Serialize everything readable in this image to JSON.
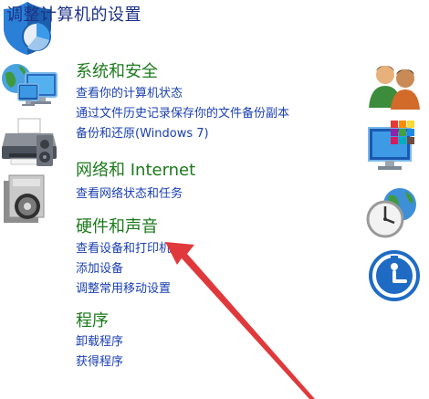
{
  "page": {
    "title": "调整计算机的设置"
  },
  "categories": [
    {
      "title": "系统和安全",
      "icon": "shield-icon",
      "links": [
        "查看你的计算机状态",
        "通过文件历史记录保存你的文件备份副本",
        "备份和还原(Windows 7)"
      ]
    },
    {
      "title": "网络和 Internet",
      "icon": "network-icon",
      "links": [
        "查看网络状态和任务"
      ]
    },
    {
      "title": "硬件和声音",
      "icon": "printer-icon",
      "links": [
        "查看设备和打印机",
        "添加设备",
        "调整常用移动设置"
      ]
    },
    {
      "title": "程序",
      "icon": "programs-icon",
      "links": [
        "卸载程序",
        "获得程序"
      ]
    }
  ],
  "side_icons": [
    "user-accounts-icon",
    "appearance-icon",
    "clock-region-icon",
    "ease-of-access-icon"
  ],
  "colors": {
    "title": "#1e3287",
    "category": "#1c7a1c",
    "link": "#1a3fb0",
    "annotation_arrow": "#e0393c"
  }
}
